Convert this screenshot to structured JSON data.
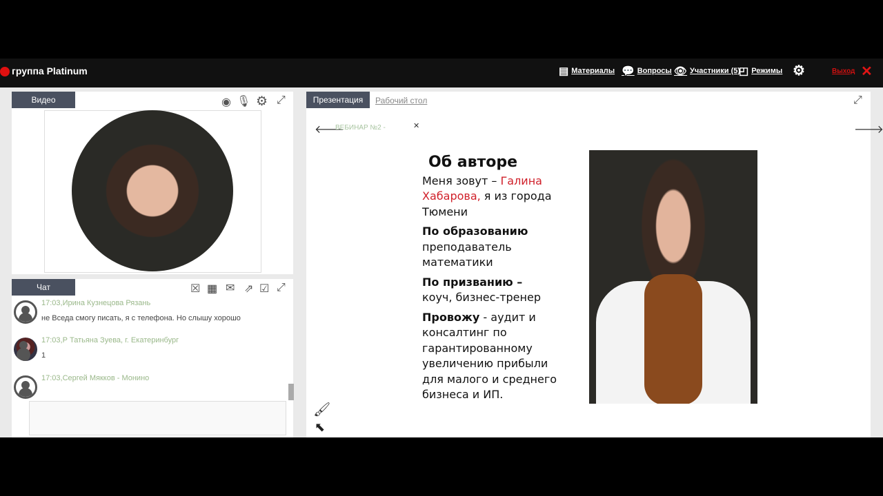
{
  "header": {
    "title": "группа Platinum",
    "nav": [
      {
        "icon": "materials-icon",
        "label": "Материалы"
      },
      {
        "icon": "questions-icon",
        "label": "Вопросы"
      },
      {
        "icon": "eye-icon",
        "label": "Участники (5)"
      },
      {
        "icon": "modes-icon",
        "label": "Режимы"
      }
    ],
    "exit": "Выход",
    "accent": "#d01010"
  },
  "video": {
    "tab": "Видео"
  },
  "chat": {
    "tab": "Чат",
    "messages": [
      {
        "meta": "17:03,Ирина Кузнецова Рязань",
        "text": "не Вседа смогу писать, я с телефона. Но слышу хорошо"
      },
      {
        "meta": "17:03,Р Татьяна Зуева, г. Екатеринбург",
        "text": "1"
      },
      {
        "meta": "17:03,Сергей Мякков - Монино",
        "text": ""
      }
    ]
  },
  "presentation": {
    "tabs": [
      "Презентация",
      "Рабочий стол"
    ],
    "doc": "ВЕБИНАР №2 -",
    "slide": {
      "title": "Об авторе",
      "l1a": "Меня зовут – ",
      "l1b": "Галина Хабарова,",
      "l1c": " я из города Тюмени",
      "h2": "По образованию",
      "t2": "преподаватель математики",
      "h3": "По призванию –",
      "t3": "коуч, бизнес-тренер",
      "h4": "Провожу",
      "t4": " - аудит и консалтинг  по гарантированному увеличению прибыли для малого и среднего бизнеса и ИП."
    }
  }
}
